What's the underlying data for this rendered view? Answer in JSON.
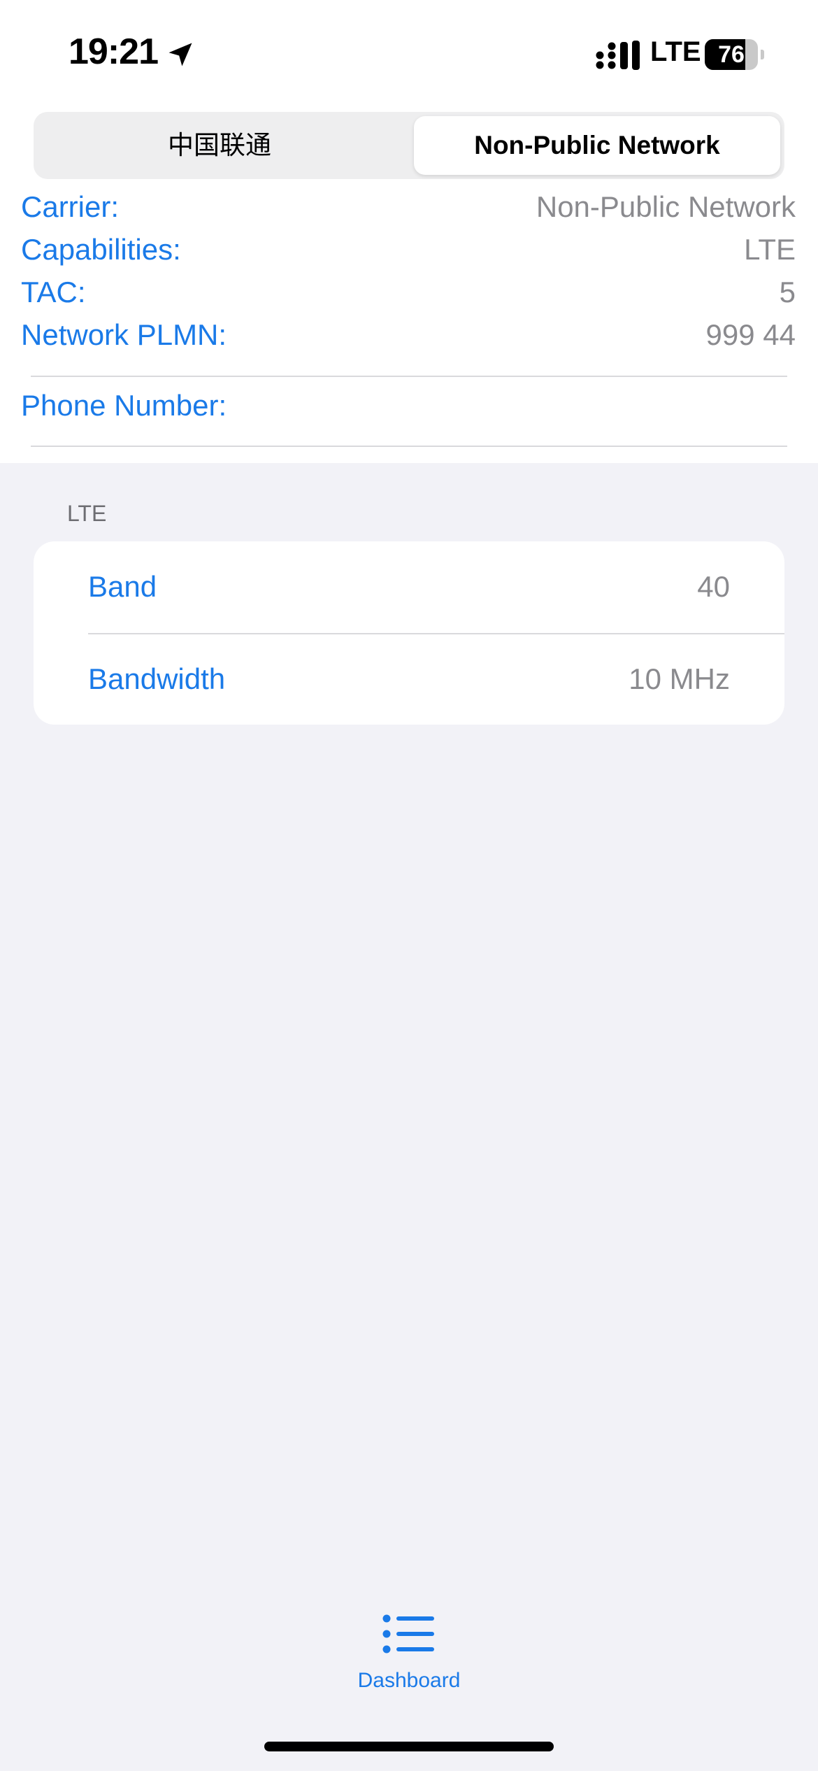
{
  "status_bar": {
    "time": "19:21",
    "network_type": "LTE",
    "battery_level": "76",
    "battery_fraction": 0.76
  },
  "segmented_control": {
    "options": [
      "中国联通",
      "Non-Public Network"
    ],
    "selected": "Non-Public Network"
  },
  "info": {
    "carrier": {
      "label": "Carrier:",
      "value": "Non-Public Network"
    },
    "capabilities": {
      "label": "Capabilities:",
      "value": "LTE"
    },
    "tac": {
      "label": "TAC:",
      "value": "5"
    },
    "network_plmn": {
      "label": "Network PLMN:",
      "value": "999 44"
    },
    "phone_number": {
      "label": "Phone Number:",
      "value": ""
    }
  },
  "section": {
    "header": "LTE",
    "rows": [
      {
        "label": "Band",
        "value": "40"
      },
      {
        "label": "Bandwidth",
        "value": "10 MHz"
      }
    ]
  },
  "tab_bar": {
    "items": [
      {
        "label": "Dashboard",
        "icon": "list-icon",
        "selected": true
      }
    ]
  },
  "colors": {
    "accent": "#1a7ae8",
    "secondary_text": "#8a8a8e",
    "background": "#f2f2f7"
  }
}
